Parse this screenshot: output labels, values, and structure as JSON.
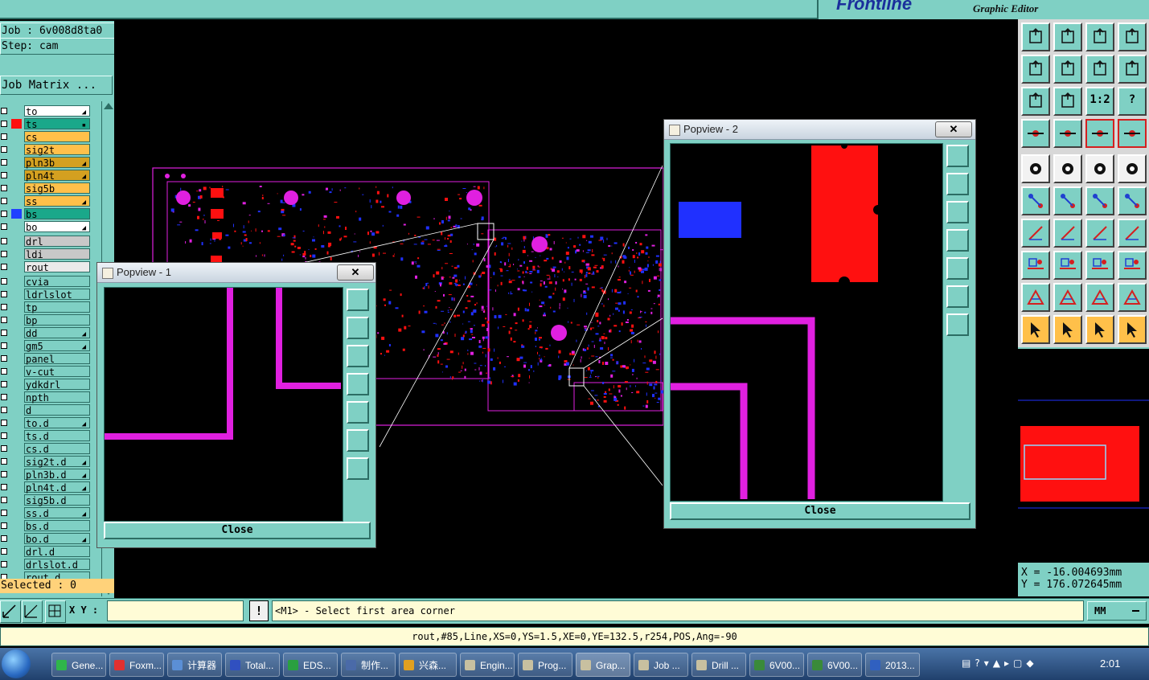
{
  "app": {
    "brand_logo": "Frontline",
    "brand_subtitle": "Graphic Editor"
  },
  "job": {
    "job_line": "Job : 6v008d8ta0",
    "step_line": "Step: cam",
    "matrix_button": "Job Matrix ...",
    "selected": "Selected : 0"
  },
  "layers": [
    {
      "name": "to",
      "bg": "#ffffff",
      "swatch": "",
      "flag": "◢"
    },
    {
      "name": "ts",
      "bg": "#1aa88a",
      "swatch": "#ff1010",
      "flag": "▪"
    },
    {
      "name": "cs",
      "bg": "#ffc04a",
      "swatch": "",
      "flag": ""
    },
    {
      "name": "sig2t",
      "bg": "#ffc04a",
      "swatch": "",
      "flag": ""
    },
    {
      "name": "pln3b",
      "bg": "#d4a020",
      "swatch": "",
      "flag": "◢"
    },
    {
      "name": "pln4t",
      "bg": "#d4a020",
      "swatch": "",
      "flag": "◢"
    },
    {
      "name": "sig5b",
      "bg": "#ffc04a",
      "swatch": "",
      "flag": ""
    },
    {
      "name": "ss",
      "bg": "#ffc04a",
      "swatch": "",
      "flag": "◢"
    },
    {
      "name": "bs",
      "bg": "#1aa88a",
      "swatch": "#2040ff",
      "flag": ""
    },
    {
      "name": "bo",
      "bg": "#ffffff",
      "swatch": "",
      "flag": "◢"
    },
    {
      "name": "drl",
      "bg": "#c8c8c8",
      "swatch": "",
      "flag": ""
    },
    {
      "name": "ldi",
      "bg": "#c8c8c8",
      "swatch": "",
      "flag": ""
    },
    {
      "name": "rout",
      "bg": "#eaeaea",
      "swatch": "",
      "flag": ""
    },
    {
      "name": "cvia",
      "bg": "#7fd0c4",
      "swatch": "",
      "flag": ""
    },
    {
      "name": "ldrlslot",
      "bg": "#7fd0c4",
      "swatch": "",
      "flag": ""
    },
    {
      "name": "tp",
      "bg": "#7fd0c4",
      "swatch": "",
      "flag": ""
    },
    {
      "name": "bp",
      "bg": "#7fd0c4",
      "swatch": "",
      "flag": ""
    },
    {
      "name": "dd",
      "bg": "#7fd0c4",
      "swatch": "",
      "flag": "◢"
    },
    {
      "name": "gm5",
      "bg": "#7fd0c4",
      "swatch": "",
      "flag": "◢"
    },
    {
      "name": "panel",
      "bg": "#7fd0c4",
      "swatch": "",
      "flag": ""
    },
    {
      "name": "v-cut",
      "bg": "#7fd0c4",
      "swatch": "",
      "flag": ""
    },
    {
      "name": "ydkdrl",
      "bg": "#7fd0c4",
      "swatch": "",
      "flag": ""
    },
    {
      "name": "npth",
      "bg": "#7fd0c4",
      "swatch": "",
      "flag": ""
    },
    {
      "name": "d",
      "bg": "#7fd0c4",
      "swatch": "",
      "flag": ""
    },
    {
      "name": "to.d",
      "bg": "#7fd0c4",
      "swatch": "",
      "flag": "◢"
    },
    {
      "name": "ts.d",
      "bg": "#7fd0c4",
      "swatch": "",
      "flag": ""
    },
    {
      "name": "cs.d",
      "bg": "#7fd0c4",
      "swatch": "",
      "flag": ""
    },
    {
      "name": "sig2t.d",
      "bg": "#7fd0c4",
      "swatch": "",
      "flag": "◢"
    },
    {
      "name": "pln3b.d",
      "bg": "#7fd0c4",
      "swatch": "",
      "flag": "◢"
    },
    {
      "name": "pln4t.d",
      "bg": "#7fd0c4",
      "swatch": "",
      "flag": "◢"
    },
    {
      "name": "sig5b.d",
      "bg": "#7fd0c4",
      "swatch": "",
      "flag": ""
    },
    {
      "name": "ss.d",
      "bg": "#7fd0c4",
      "swatch": "",
      "flag": "◢"
    },
    {
      "name": "bs.d",
      "bg": "#7fd0c4",
      "swatch": "",
      "flag": ""
    },
    {
      "name": "bo.d",
      "bg": "#7fd0c4",
      "swatch": "",
      "flag": "◢"
    },
    {
      "name": "drl.d",
      "bg": "#7fd0c4",
      "swatch": "",
      "flag": ""
    },
    {
      "name": "drlslot.d",
      "bg": "#7fd0c4",
      "swatch": "",
      "flag": ""
    },
    {
      "name": "rout.d",
      "bg": "#7fd0c4",
      "swatch": "",
      "flag": ""
    }
  ],
  "toolbar": {
    "tools": [
      {
        "icon": "pan-up-icon",
        "style": "teal",
        "glyph": ""
      },
      {
        "icon": "pan-down-icon",
        "style": "teal",
        "glyph": ""
      },
      {
        "icon": "home-view-icon",
        "style": "teal",
        "glyph": ""
      },
      {
        "icon": "split-view-icon",
        "style": "teal",
        "glyph": ""
      },
      {
        "icon": "pan-left-icon",
        "style": "teal",
        "glyph": ""
      },
      {
        "icon": "pan-right-icon",
        "style": "teal",
        "glyph": ""
      },
      {
        "icon": "rotate-view-icon",
        "style": "teal",
        "glyph": ""
      },
      {
        "icon": "redraw-icon",
        "style": "teal",
        "glyph": ""
      },
      {
        "icon": "zoom-fit-icon",
        "style": "teal",
        "glyph": ""
      },
      {
        "icon": "zoom-center-icon",
        "style": "teal",
        "glyph": ""
      },
      {
        "icon": "one-to-one-icon",
        "style": "teal",
        "glyph": "1:2"
      },
      {
        "icon": "help-icon",
        "style": "teal",
        "glyph": "?"
      },
      {
        "icon": "measure-tool-icon",
        "style": "teal",
        "glyph": ""
      },
      {
        "icon": "probe-icon",
        "style": "teal",
        "glyph": ""
      },
      {
        "icon": "netlist-highlight-icon",
        "style": "teal",
        "glyph": "",
        "active": true
      },
      {
        "icon": "netlist-compare-icon",
        "style": "teal",
        "glyph": "",
        "active": true
      },
      {
        "icon": "add-pad-icon",
        "style": "white",
        "glyph": ""
      },
      {
        "icon": "add-line-icon",
        "style": "white",
        "glyph": ""
      },
      {
        "icon": "ruler-icon",
        "style": "white",
        "glyph": ""
      },
      {
        "icon": "add-circle-icon",
        "style": "white",
        "glyph": ""
      },
      {
        "icon": "connect-nodes-icon",
        "style": "teal",
        "glyph": ""
      },
      {
        "icon": "delete-node-icon",
        "style": "teal",
        "glyph": ""
      },
      {
        "icon": "move-node-icon",
        "style": "teal",
        "glyph": ""
      },
      {
        "icon": "copy-node-icon",
        "style": "teal",
        "glyph": ""
      },
      {
        "icon": "draw-angle-icon",
        "style": "teal",
        "glyph": ""
      },
      {
        "icon": "draw-slash-icon",
        "style": "teal",
        "glyph": ""
      },
      {
        "icon": "arc-tool-icon",
        "style": "teal",
        "glyph": ""
      },
      {
        "icon": "mirror-tool-icon",
        "style": "teal",
        "glyph": ""
      },
      {
        "icon": "snap-point-icon",
        "style": "teal",
        "glyph": ""
      },
      {
        "icon": "horizontal-line-icon",
        "style": "teal",
        "glyph": ""
      },
      {
        "icon": "stretch-icon",
        "style": "teal",
        "glyph": ""
      },
      {
        "icon": "group-shapes-icon",
        "style": "teal",
        "glyph": ""
      },
      {
        "icon": "text-angle-icon",
        "style": "teal",
        "glyph": ""
      },
      {
        "icon": "text-a-icon",
        "style": "teal",
        "glyph": ""
      },
      {
        "icon": "text-a-blue-icon",
        "style": "teal",
        "glyph": ""
      },
      {
        "icon": "text-a-red-icon",
        "style": "teal",
        "glyph": ""
      },
      {
        "icon": "select-arrow-icon",
        "style": "yellow",
        "glyph": ""
      },
      {
        "icon": "select-box-icon",
        "style": "yellow",
        "glyph": ""
      },
      {
        "icon": "select-lasso-icon",
        "style": "yellow",
        "glyph": ""
      },
      {
        "icon": "select-path-icon",
        "style": "yellow",
        "glyph": ""
      }
    ]
  },
  "coords": {
    "x": "X = -16.004693mm",
    "y": "Y = 176.072645mm"
  },
  "command": {
    "xy_label": "X Y :",
    "xy_value": "",
    "bang": "!",
    "prompt": "<M1> - Select first area corner",
    "units": "MM",
    "status": "rout,#85,Line,XS=0,YS=1.5,XE=0,YE=132.5,r254,POS,Ang=-90"
  },
  "popview1": {
    "title": "Popview - 1",
    "close_x": "✕",
    "close": "Close"
  },
  "popview2": {
    "title": "Popview - 2",
    "close_x": "✕",
    "close": "Close"
  },
  "taskbar": {
    "items": [
      {
        "label": "Gene...",
        "color": "#2fb64a"
      },
      {
        "label": "Foxm...",
        "color": "#e03030"
      },
      {
        "label": "计算器",
        "color": "#5b8fd6"
      },
      {
        "label": "Total...",
        "color": "#3050c0"
      },
      {
        "label": "EDS...",
        "color": "#2aa040"
      },
      {
        "label": "制作...",
        "color": "#4a6aa8"
      },
      {
        "label": "兴森...",
        "color": "#e0a020"
      },
      {
        "label": "Engin...",
        "color": "#c8c0a0"
      },
      {
        "label": "Prog...",
        "color": "#c8c0a0"
      },
      {
        "label": "Grap...",
        "color": "#c8c0a0",
        "active": true
      },
      {
        "label": "Job ...",
        "color": "#c8c0a0"
      },
      {
        "label": "Drill ...",
        "color": "#c8c0a0"
      },
      {
        "label": "6V00...",
        "color": "#3a8a3a"
      },
      {
        "label": "6V00...",
        "color": "#3a8a3a"
      },
      {
        "label": "2013...",
        "color": "#3060c0"
      }
    ],
    "clock": "2:01"
  },
  "colors": {
    "panel": "#7fd0c4",
    "pcb_magenta": "#e020e0",
    "pcb_red": "#ff1010",
    "pcb_blue": "#2030ff",
    "prompt_bg": "#fffcd6"
  }
}
